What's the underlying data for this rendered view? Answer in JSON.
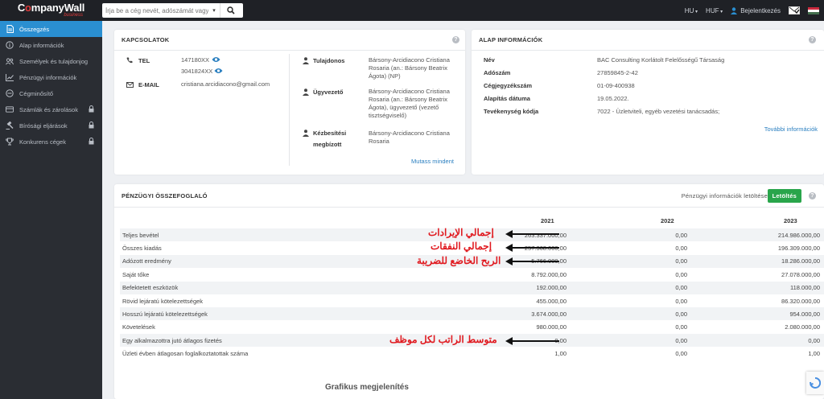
{
  "header": {
    "brand_pre": "C",
    "brand_o": "o",
    "brand_post": "mpanyWall",
    "brand_sub": "business",
    "search_placeholder": "Írja be a cég nevét, adószámát vagy",
    "lang": "HU",
    "currency": "HUF",
    "login": "Bejelentkezés"
  },
  "sidebar": {
    "items": [
      {
        "label": "Összegzés",
        "icon": "document-icon"
      },
      {
        "label": "Alap információk",
        "icon": "info-icon"
      },
      {
        "label": "Személyek és tulajdonjog",
        "icon": "people-icon"
      },
      {
        "label": "Pénzügyi információk",
        "icon": "chart-icon"
      },
      {
        "label": "Cégminősítő",
        "icon": "gauge-icon"
      },
      {
        "label": "Számlák és zárolások",
        "icon": "card-icon"
      },
      {
        "label": "Bírósági eljárások",
        "icon": "gavel-icon"
      },
      {
        "label": "Konkurens cégek",
        "icon": "trophy-icon"
      }
    ]
  },
  "contacts": {
    "title": "KAPCSOLATOK",
    "tel_label": "TEL",
    "tel1": "147180XX",
    "tel2": "3041824XX",
    "email_label": "E-MAIL",
    "email": "cristiana.arcidiacono@gmail.com",
    "owner_label": "Tulajdonos",
    "owner": "Bársony-Arcidiacono Cristiana Rosaria (an.: Bársony Beatrix Ágota) (NP)",
    "manager_label": "Ügyvezető",
    "manager": "Bársony-Arcidiacono Cristiana Rosaria (an.: Bársony Beatrix Ágota), ügyvezető (vezető tisztségviselő)",
    "delivery_label1": "Kézbesítési",
    "delivery_label2": "megbízott",
    "delivery": "Bársony-Arcidiacono Cristiana Rosaria",
    "show_all": "Mutass mindent"
  },
  "basic": {
    "title": "ALAP INFORMÁCIÓK",
    "rows": [
      {
        "label": "Név",
        "value": "BAC Consulting Korlátolt Felelősségű Társaság"
      },
      {
        "label": "Adószám",
        "value": "27859845-2-42"
      },
      {
        "label": "Cégjegyzékszám",
        "value": "01-09-400938"
      },
      {
        "label": "Alapítás dátuma",
        "value": "19.05.2022."
      },
      {
        "label": "Tevékenység kódja",
        "value": "7022 - Üzletviteli, egyéb vezetési tanácsadás;"
      }
    ],
    "more": "További információk"
  },
  "finance": {
    "title": "PÉNZÜGYI ÖSSZEFOGLALÓ",
    "download_text": "Pénzügyi információk letöltése",
    "download_btn": "Letöltés",
    "years": [
      "2021",
      "2022",
      "2023"
    ],
    "rows": [
      {
        "name": "Teljes bevétel",
        "v": [
          "0,00",
          "263.337.000,00",
          "214.986.000,00"
        ]
      },
      {
        "name": "Összes kiadás",
        "v": [
          "0,00",
          "257.368.000,00",
          "196.309.000,00"
        ]
      },
      {
        "name": "Adózott eredmény",
        "v": [
          "0,00",
          "5.766.000,00",
          "18.286.000,00"
        ]
      },
      {
        "name": "Saját tőke",
        "v": [
          "0,00",
          "8.792.000,00",
          "27.078.000,00"
        ]
      },
      {
        "name": "Befektetett eszközök",
        "v": [
          "0,00",
          "192.000,00",
          "118.000,00"
        ]
      },
      {
        "name": "Rövid lejáratú kötelezettségek",
        "v": [
          "0,00",
          "455.000,00",
          "86.320.000,00"
        ]
      },
      {
        "name": "Hosszú lejáratú kötelezettségek",
        "v": [
          "0,00",
          "3.674.000,00",
          "954.000,00"
        ]
      },
      {
        "name": "Követelések",
        "v": [
          "0,00",
          "980.000,00",
          "2.080.000,00"
        ]
      },
      {
        "name": "Egy alkalmazottra jutó átlagos fizetés",
        "v": [
          "0,00",
          "0,00",
          "0,00"
        ]
      },
      {
        "name": "Üzleti évben átlagosan foglalkoztatottak száma",
        "v": [
          "0,00",
          "1,00",
          "1,00"
        ]
      }
    ],
    "chart_heading": "Grafikus megjelenítés"
  },
  "annotations": {
    "a1": "إجمالي الإيرادات",
    "a2": "إجمالي النفقات",
    "a3": "الربح الخاضع للضريبة",
    "a4": "متوسط الراتب لكل موظف"
  },
  "colors": {
    "accent": "#2a8fd1",
    "annotation": "#e0181e",
    "button": "#29a54b"
  }
}
